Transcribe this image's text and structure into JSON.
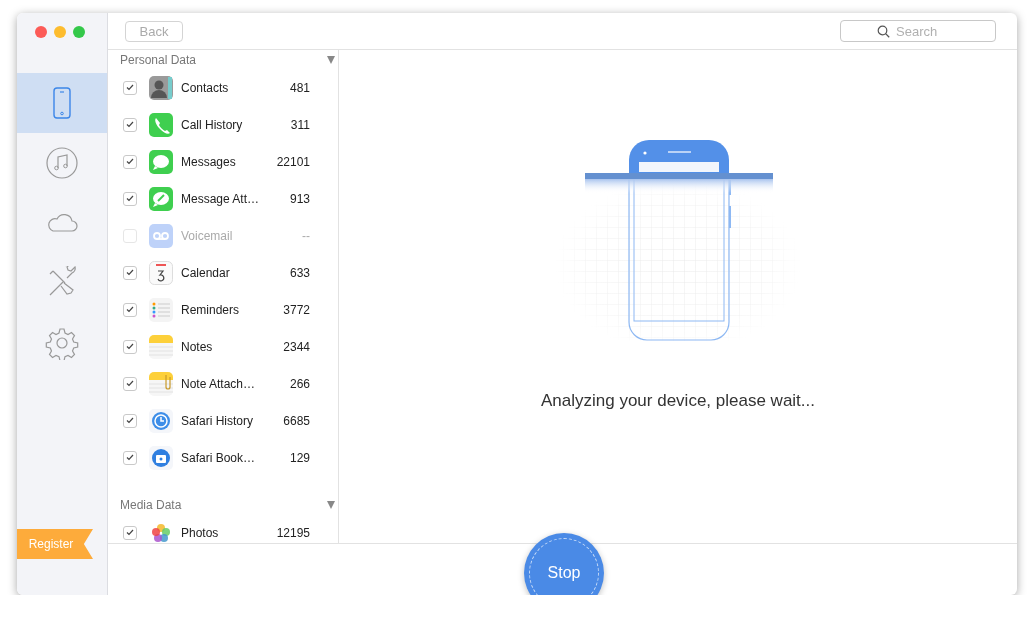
{
  "toolbar": {
    "back_button": "Back",
    "search": {
      "placeholder": "Search"
    }
  },
  "sidebar": {
    "items": [
      {
        "kind": "phone",
        "selected": true
      },
      {
        "kind": "music",
        "selected": false
      },
      {
        "kind": "cloud",
        "selected": false
      },
      {
        "kind": "tools",
        "selected": false
      },
      {
        "kind": "settings",
        "selected": false
      }
    ],
    "register": "Register"
  },
  "sections": [
    {
      "title": "Personal Data",
      "expanded": true,
      "items": [
        {
          "kind": "contacts",
          "label": "Contacts",
          "count": "481",
          "checked": true,
          "disabled": false
        },
        {
          "kind": "phone",
          "label": "Call History",
          "count": "311",
          "checked": true,
          "disabled": false
        },
        {
          "kind": "messages",
          "label": "Messages",
          "count": "22101",
          "checked": true,
          "disabled": false
        },
        {
          "kind": "attachment",
          "label": "Message Att…",
          "count": "913",
          "checked": true,
          "disabled": false
        },
        {
          "kind": "voicemail",
          "label": "Voicemail",
          "count": "--",
          "checked": false,
          "disabled": true
        },
        {
          "kind": "calendar",
          "label": "Calendar",
          "count": "633",
          "checked": true,
          "disabled": false
        },
        {
          "kind": "reminders",
          "label": "Reminders",
          "count": "3772",
          "checked": true,
          "disabled": false
        },
        {
          "kind": "notes",
          "label": "Notes",
          "count": "2344",
          "checked": true,
          "disabled": false
        },
        {
          "kind": "note_attach",
          "label": "Note Attach…",
          "count": "266",
          "checked": true,
          "disabled": false
        },
        {
          "kind": "history",
          "label": "Safari History",
          "count": "6685",
          "checked": true,
          "disabled": false
        },
        {
          "kind": "bookmark",
          "label": "Safari Book…",
          "count": "129",
          "checked": true,
          "disabled": false
        }
      ]
    },
    {
      "title": "Media Data",
      "expanded": true,
      "items": [
        {
          "kind": "photos",
          "label": "Photos",
          "count": "12195",
          "checked": true,
          "disabled": false
        }
      ]
    }
  ],
  "status": "Analyzing your device, please wait...",
  "stop_button": "Stop"
}
